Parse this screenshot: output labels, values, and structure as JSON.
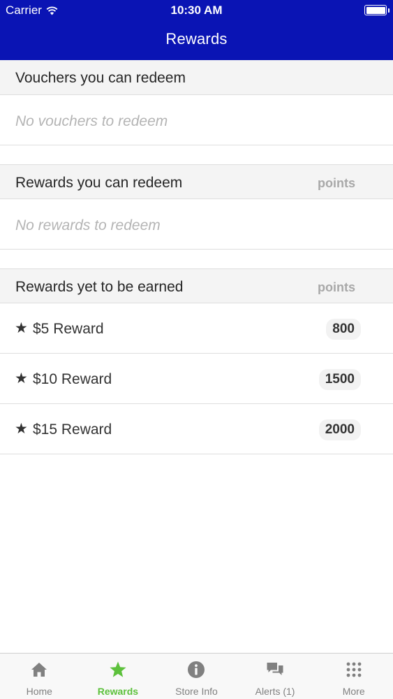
{
  "status_bar": {
    "carrier": "Carrier",
    "time": "10:30 AM"
  },
  "nav": {
    "title": "Rewards"
  },
  "sections": {
    "vouchers": {
      "title": "Vouchers you can redeem",
      "empty_text": "No vouchers to redeem"
    },
    "redeemable": {
      "title": "Rewards you can redeem",
      "points_label": "points",
      "empty_text": "No rewards to redeem"
    },
    "to_earn": {
      "title": "Rewards yet to be earned",
      "points_label": "points",
      "items": [
        {
          "star": "★",
          "name": "$5 Reward",
          "points": "800"
        },
        {
          "star": "★",
          "name": "$10 Reward",
          "points": "1500"
        },
        {
          "star": "★",
          "name": "$15 Reward",
          "points": "2000"
        }
      ]
    }
  },
  "tabs": [
    {
      "label": "Home",
      "icon": "home-icon"
    },
    {
      "label": "Rewards",
      "icon": "star-icon",
      "active": true
    },
    {
      "label": "Store Info",
      "icon": "info-icon"
    },
    {
      "label": "Alerts (1)",
      "icon": "chat-bubbles-icon"
    },
    {
      "label": "More",
      "icon": "grid-dots-icon"
    }
  ],
  "colors": {
    "header_bg": "#0a14b4",
    "tab_active": "#5dc13c",
    "tab_inactive": "#808080"
  }
}
